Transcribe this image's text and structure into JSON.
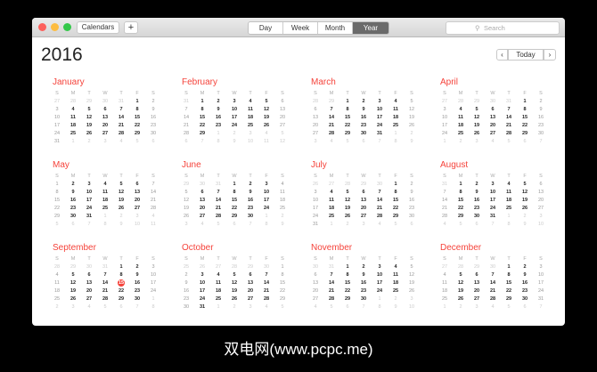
{
  "toolbar": {
    "calendars": "Calendars",
    "add": "+",
    "views": [
      "Day",
      "Week",
      "Month",
      "Year"
    ],
    "active_view": "Year",
    "search_placeholder": "Search"
  },
  "header": {
    "year": "2016",
    "prev": "‹",
    "today": "Today",
    "next": "›"
  },
  "weekdays": [
    "S",
    "M",
    "T",
    "W",
    "T",
    "F",
    "S"
  ],
  "today": {
    "month": 8,
    "day": 15
  },
  "months": [
    {
      "name": "January",
      "lead": [
        27,
        28,
        29,
        30,
        31
      ],
      "days": 31,
      "trail": 6
    },
    {
      "name": "February",
      "lead": [
        31
      ],
      "days": 29,
      "trail": 12
    },
    {
      "name": "March",
      "lead": [
        28,
        29
      ],
      "days": 31,
      "trail": 9
    },
    {
      "name": "April",
      "lead": [
        27,
        28,
        29,
        30,
        31
      ],
      "days": 30,
      "trail": 7
    },
    {
      "name": "May",
      "lead": [],
      "days": 31,
      "trail": 11
    },
    {
      "name": "June",
      "lead": [
        29,
        30,
        31
      ],
      "days": 30,
      "trail": 9
    },
    {
      "name": "July",
      "lead": [
        26,
        27,
        28,
        29,
        30
      ],
      "days": 31,
      "trail": 6
    },
    {
      "name": "August",
      "lead": [
        31
      ],
      "days": 31,
      "trail": 10
    },
    {
      "name": "September",
      "lead": [
        28,
        29,
        30,
        31
      ],
      "days": 30,
      "trail": 8
    },
    {
      "name": "October",
      "lead": [
        25,
        26,
        27,
        28,
        29,
        30
      ],
      "days": 31,
      "trail": 5
    },
    {
      "name": "November",
      "lead": [
        30,
        31
      ],
      "days": 30,
      "trail": 10
    },
    {
      "name": "December",
      "lead": [
        27,
        28,
        29,
        30
      ],
      "days": 31,
      "trail": 7
    }
  ],
  "caption": "双电网(www.pcpc.me)"
}
